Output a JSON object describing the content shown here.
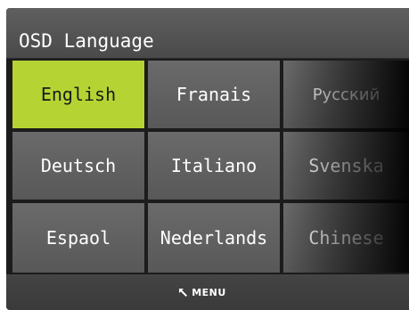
{
  "title": "OSD Language",
  "languages": [
    [
      "English",
      "Franais",
      "Русский"
    ],
    [
      "Deutsch",
      "Italiano",
      "Svenska"
    ],
    [
      "Espaol",
      "Nederlands",
      "Chinese"
    ]
  ],
  "selected_language": "English",
  "footer": {
    "menu_label": "MENU",
    "menu_icon": "back-arrow-icon"
  },
  "colors": {
    "selected": "#b5d433",
    "tile": "#606060",
    "background": "#1c1c1c"
  }
}
